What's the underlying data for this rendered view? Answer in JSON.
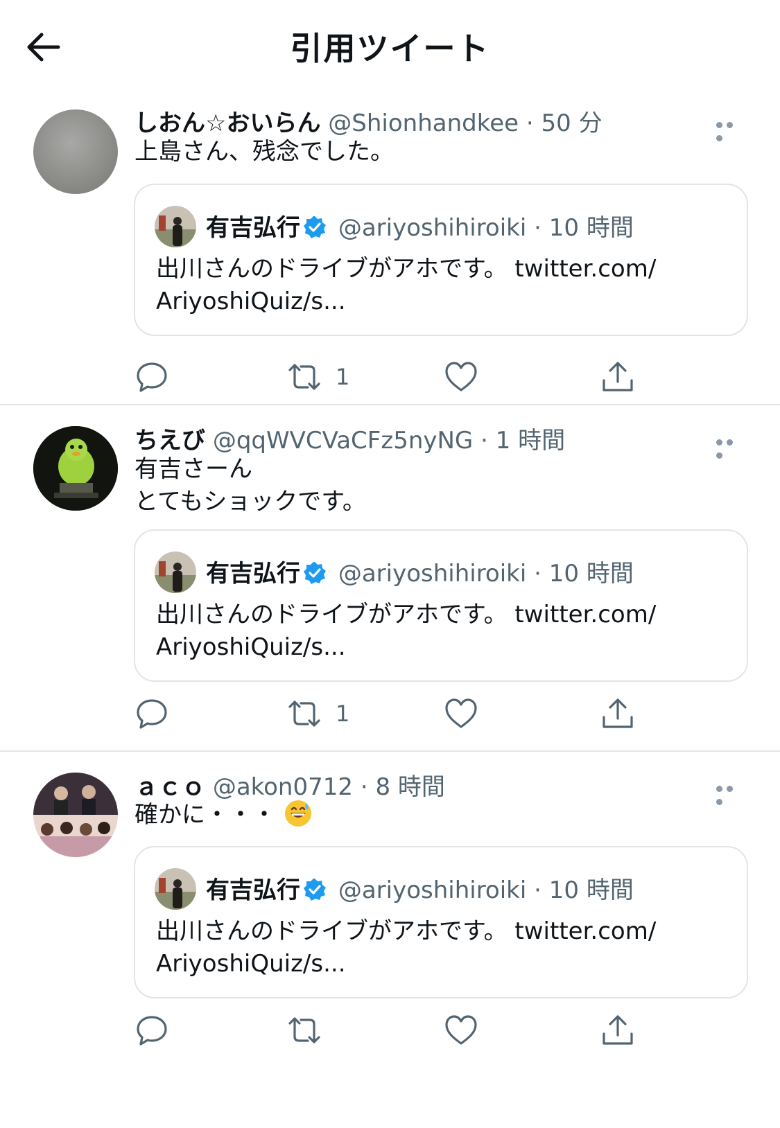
{
  "header": {
    "title": "引用ツイート"
  },
  "quoted": {
    "name": "有吉弘行",
    "handle": "@ariyoshihiroiki",
    "dot": "·",
    "time": "10 時間",
    "text": "出川さんのドライブがアホです。 twitter.com/\nAriyoshiQuiz/s..."
  },
  "tweets": [
    {
      "name": "しおん☆おいらん",
      "handle": "@Shionhandkee",
      "dot": "·",
      "time": "50 分",
      "text": "上島さん、残念でした。",
      "retweet_count": "1"
    },
    {
      "name": "ちえび",
      "handle": "@qqWVCVaCFz5nyNG",
      "dot": "·",
      "time": "1 時間",
      "text": "有吉さーん\nとてもショックです。",
      "retweet_count": "1"
    },
    {
      "name": "ａｃｏ",
      "handle": "@akon0712",
      "dot": "·",
      "time": "8 時間",
      "text": "確かに・・・",
      "emoji": "grinning-sweat-emoji",
      "retweet_count": ""
    }
  ],
  "icons": {
    "back": "arrow-left-icon",
    "more": "more-dots-icon",
    "reply": "reply-icon",
    "retweet": "retweet-icon",
    "like": "heart-icon",
    "share": "share-icon",
    "verified": "verified-badge-icon"
  },
  "colors": {
    "text": "#0f1419",
    "secondary": "#536471",
    "verified": "#1d9bf0",
    "border": "#e1e5e8"
  }
}
